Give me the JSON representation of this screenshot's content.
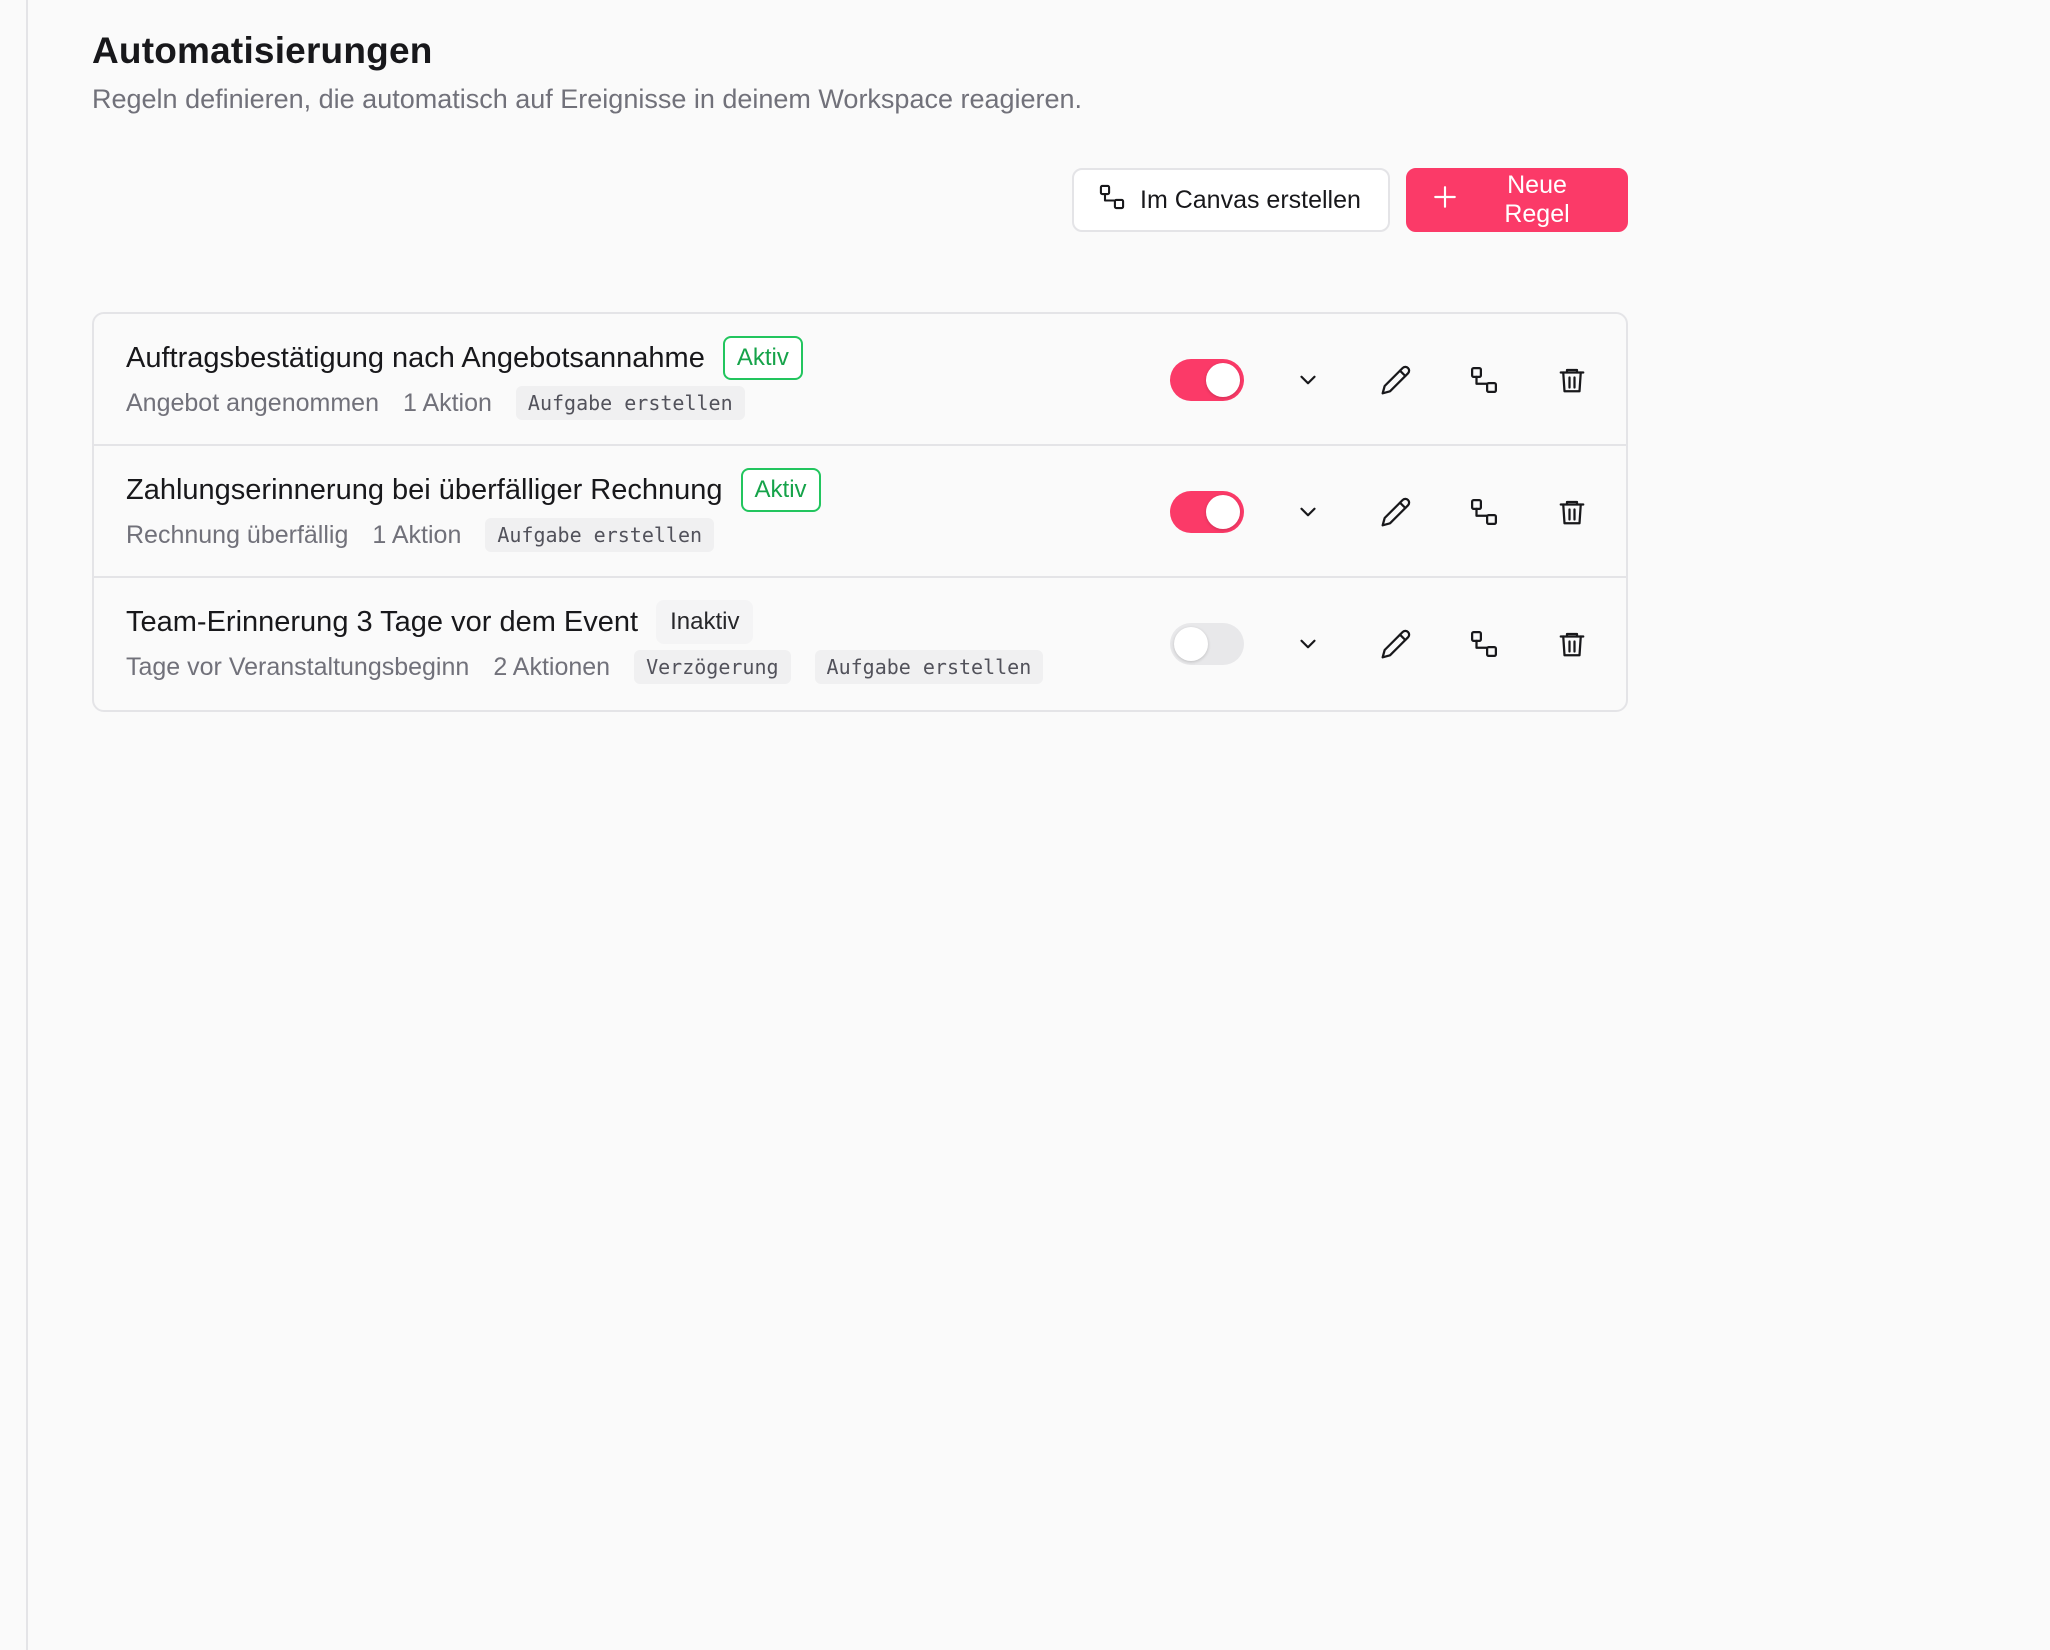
{
  "header": {
    "title": "Automatisierungen",
    "subtitle": "Regeln definieren, die automatisch auf Ereignisse in deinem Workspace reagieren."
  },
  "toolbar": {
    "canvas_label": "Im Canvas erstellen",
    "new_rule_label": "Neue Regel"
  },
  "colors": {
    "accent": "#fb3a68",
    "active_green": "#16a34a",
    "muted_text": "#71717a"
  },
  "icons": {
    "canvas": "flow-icon",
    "new_rule": "plus-icon",
    "expand": "chevron-down-icon",
    "edit": "pencil-icon",
    "open_canvas": "flow-icon",
    "delete": "trash-icon"
  },
  "rules": [
    {
      "name": "Auftragsbestätigung nach Angebotsannahme",
      "status": "Aktiv",
      "enabled": true,
      "trigger": "Angebot angenommen",
      "action_count": "1 Aktion",
      "actions": [
        "Aufgabe erstellen"
      ]
    },
    {
      "name": "Zahlungserinnerung bei überfälliger Rechnung",
      "status": "Aktiv",
      "enabled": true,
      "trigger": "Rechnung überfällig",
      "action_count": "1 Aktion",
      "actions": [
        "Aufgabe erstellen"
      ]
    },
    {
      "name": "Team-Erinnerung 3 Tage vor dem Event",
      "status": "Inaktiv",
      "enabled": false,
      "trigger": "Tage vor Veranstaltungsbeginn",
      "action_count": "2 Aktionen",
      "actions": [
        "Verzögerung",
        "Aufgabe erstellen"
      ]
    }
  ]
}
